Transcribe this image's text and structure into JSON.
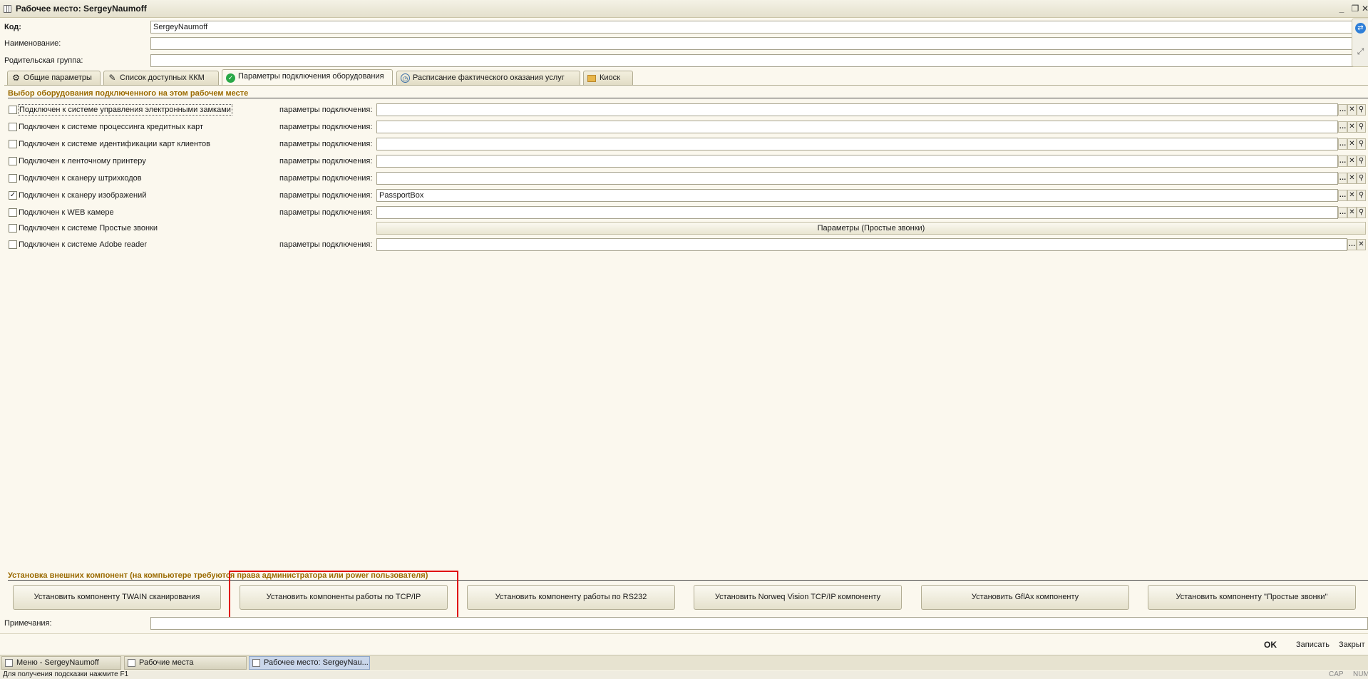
{
  "window": {
    "title": "Рабочее место: SergeyNaumoff"
  },
  "header": {
    "code_label": "Код:",
    "code_value": "SergeyNaumoff",
    "name_label": "Наименование:",
    "name_value": "",
    "parent_label": "Родительская группа:",
    "parent_value": ""
  },
  "tabs": [
    {
      "label": "Общие параметры",
      "icon": "gear-icon"
    },
    {
      "label": "Список доступных ККМ",
      "icon": "pencil-icon"
    },
    {
      "label": "Параметры подключения оборудования",
      "icon": "check-circle-icon"
    },
    {
      "label": "Расписание фактического оказания услуг",
      "icon": "clock-icon"
    },
    {
      "label": "Киоск",
      "icon": "folder-icon"
    }
  ],
  "equipment": {
    "section_title": "Выбор оборудования подключенного на этом рабочем месте",
    "param_label": "параметры подключения:",
    "rows": [
      {
        "label": "Подключен к системе управления электронными замками",
        "checked": false,
        "value": ""
      },
      {
        "label": "Подключен к системе процессинга кредитных карт",
        "checked": false,
        "value": ""
      },
      {
        "label": "Подключен к системе идентификации карт клиентов",
        "checked": false,
        "value": ""
      },
      {
        "label": "Подключен к ленточному принтеру",
        "checked": false,
        "value": ""
      },
      {
        "label": "Подключен к сканеру штрихкодов",
        "checked": false,
        "value": ""
      },
      {
        "label": "Подключен к сканеру изображений",
        "checked": true,
        "value": "PassportBox"
      },
      {
        "label": "Подключен к WEB камере",
        "checked": false,
        "value": ""
      },
      {
        "label": "Подключен к системе Простые звонки",
        "checked": false,
        "button": "Параметры (Простые звонки)"
      },
      {
        "label": "Подключен к системе Adobe reader",
        "checked": false,
        "value": ""
      }
    ]
  },
  "components": {
    "section_title": "Установка внешних компонент (на компьютере требуются права администратора или power пользователя)",
    "buttons": [
      "Установить компоненту TWAIN сканирования",
      "Установить компоненты работы по TCP/IP",
      "Установить компоненту работы по RS232",
      "Установить Norweq Vision TCP/IP компоненту",
      "Установить GflAx компоненту",
      "Установить компоненту \"Простые звонки\""
    ]
  },
  "notes": {
    "label": "Примечания:",
    "value": ""
  },
  "footer": {
    "ok": "OK",
    "save": "Записать",
    "close": "Закрыт"
  },
  "taskbar": [
    {
      "label": "Меню - SergeyNaumoff",
      "active": false
    },
    {
      "label": "Рабочие места",
      "active": false
    },
    {
      "label": "Рабочее место: SergeyNau...",
      "active": true
    }
  ],
  "status": {
    "hint": "Для получения подсказки нажмите F1",
    "cap": "CAP",
    "num": "NUM"
  },
  "colors": {
    "highlight": "#e00000",
    "section": "#9a6a00",
    "background": "#fbf8ee"
  }
}
